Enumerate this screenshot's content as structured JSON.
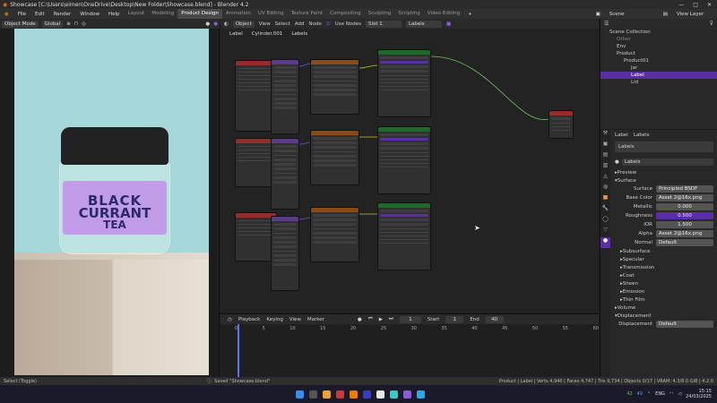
{
  "window": {
    "title": "Showcase [C:\\Users\\eimen\\OneDrive\\Desktop\\New Folder\\Showcase.blend] - Blender 4.2",
    "controls": [
      "—",
      "□",
      "✕"
    ]
  },
  "menubar": {
    "menus": [
      "File",
      "Edit",
      "Render",
      "Window",
      "Help"
    ],
    "workspaces": [
      "Layout",
      "Modeling",
      "Product Design",
      "Animation",
      "UV Editing",
      "Texture Paint",
      "Compositing",
      "Sculpting",
      "Scripting",
      "Video Editing"
    ],
    "active_workspace": "Product Design",
    "scene_label": "Scene",
    "view_layer_label": "View Layer"
  },
  "viewport": {
    "mode": "Object Mode",
    "orientation": "Global",
    "label_text": [
      "BLACK",
      "CURRANT",
      "TEA"
    ]
  },
  "node_editor": {
    "header": [
      "Object",
      "View",
      "Select",
      "Add",
      "Node"
    ],
    "use_nodes": "Use Nodes",
    "slot": "Slot 1",
    "material": "Labels",
    "breadcrumb": [
      "Label",
      "Cylinder.001",
      "Labels"
    ],
    "node_titles": {
      "bsdf": "Principled BSDF",
      "output": "Material Output",
      "tex": "Asset 2@16x.png",
      "coord": "Texture Coordinate",
      "map": "Mapping"
    }
  },
  "timeline": {
    "header": [
      "Playback",
      "Keying",
      "View",
      "Marker"
    ],
    "current_frame": "1",
    "start_label": "Start",
    "start": "1",
    "end_label": "End",
    "end": "40",
    "ticks": [
      "0",
      "5",
      "10",
      "15",
      "20",
      "25",
      "30",
      "35",
      "40",
      "45",
      "50",
      "55",
      "60"
    ]
  },
  "outliner": {
    "rows": [
      {
        "name": "Scene Collection",
        "selected": false
      },
      {
        "name": "Other",
        "selected": false
      },
      {
        "name": "Env",
        "selected": false
      },
      {
        "name": "Product",
        "selected": false
      },
      {
        "name": "Product01",
        "selected": false
      },
      {
        "name": "Jar",
        "selected": false
      },
      {
        "name": "Label",
        "selected": true
      },
      {
        "name": "Lid",
        "selected": false
      }
    ]
  },
  "properties": {
    "object": "Label",
    "material_tab": "Labels",
    "material_slot": "Labels",
    "material_name": "Labels",
    "sections_top": [
      "Preview",
      "Surface"
    ],
    "rows": [
      {
        "label": "Surface",
        "value": "Principled BSDF",
        "purple": false
      },
      {
        "label": "Base Color",
        "value": "Asset 2@16x.png",
        "purple": false
      },
      {
        "label": "Metallic",
        "value": "0.000",
        "purple": false
      },
      {
        "label": "Roughness",
        "value": "0.500",
        "purple": true
      },
      {
        "label": "IOR",
        "value": "1.500",
        "purple": false
      },
      {
        "label": "Alpha",
        "value": "Asset 2@16x.png",
        "purple": false
      },
      {
        "label": "Normal",
        "value": "Default",
        "purple": false
      }
    ],
    "sub_sections": [
      "Subsurface",
      "Specular",
      "Transmission",
      "Coat",
      "Sheen",
      "Emission",
      "Thin Film"
    ],
    "bottom_sections": [
      "Volume",
      "Displacement"
    ],
    "displacement": {
      "label": "Displacement",
      "value": "Default"
    }
  },
  "status": {
    "left": "Select (Toggle)",
    "center": "Saved \"Showcase.blend\"",
    "right": "Product | Label | Verts 4,940 | Faces 4,747 | Tris 9,734 | Objects 0/17 | VRAM: 4.3/8.0 GiB | 4.2.0"
  },
  "taskbar": {
    "temp": "42",
    "temp2": "49",
    "lang": "ENG",
    "time": "15:15",
    "date": "24/03/2025"
  }
}
